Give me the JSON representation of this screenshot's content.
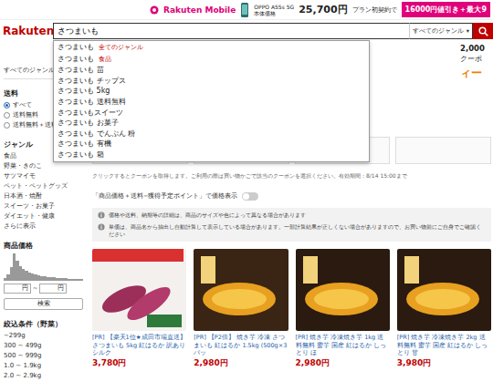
{
  "banner": {
    "brand": "Rakuten Mobile",
    "phone": "OPPO A55s 5G",
    "price_label": "本体価格",
    "price": "25,700円",
    "plan": "プラン初契約で",
    "offer": "16000円値引き＋最大9"
  },
  "header": {
    "logo": "Rakuten",
    "query": "さつまいも",
    "genre": "すべてのジャンル",
    "genre_arrow": "▾"
  },
  "suggestions": [
    {
      "text": "さつまいも",
      "tag": "全てのジャンル"
    },
    {
      "text": "さつまいも",
      "tag": "食品"
    },
    {
      "text": "さつまいも 苗",
      "tag": ""
    },
    {
      "text": "さつまいも チップス",
      "tag": ""
    },
    {
      "text": "さつまいも 5kg",
      "tag": ""
    },
    {
      "text": "さつまいも 送料無料",
      "tag": ""
    },
    {
      "text": "さつまいもスイーツ",
      "tag": ""
    },
    {
      "text": "さつまいも お菓子",
      "tag": ""
    },
    {
      "text": "さつまいも でんぷん 粉",
      "tag": ""
    },
    {
      "text": "さつまいも 有機",
      "tag": ""
    },
    {
      "text": "さつまいも 箱",
      "tag": ""
    }
  ],
  "promo": {
    "coupon_amount": "2,000",
    "coupon_label": "クーポ",
    "text": "ィー"
  },
  "sidebar": {
    "all_genres": "すべてのジャンル",
    "all_arrow": ">",
    "shipping": {
      "title": "送料",
      "options": [
        {
          "label": "すべて",
          "selected": true
        },
        {
          "label": "送料無料",
          "selected": false
        },
        {
          "label": "送料無料＋送料...",
          "selected": false
        }
      ]
    },
    "genre": {
      "title": "ジャンル",
      "items": [
        "食品",
        "野菜・きのこ",
        "サツマイモ",
        "ペット・ペットグッズ",
        "日本酒・焼酎",
        "スイーツ・お菓子",
        "ダイエット・健康"
      ],
      "more": "さらに表示"
    },
    "price": {
      "title": "商品価格",
      "histogram": [
        2,
        6,
        14,
        30,
        22,
        16,
        12,
        10,
        8,
        7,
        6,
        5,
        4,
        4,
        3,
        3,
        3,
        2,
        2,
        2,
        2,
        1,
        1,
        1,
        1,
        1
      ],
      "min_unit": "円",
      "separator": "~",
      "max_unit": "円",
      "button": "検索"
    },
    "weight": {
      "title": "絞込条件（野菜）",
      "items": [
        "~299g",
        "300 ~ 499g",
        "500 ~ 999g",
        "1.0 ~ 1.9kg",
        "2.0 ~ 2.9kg"
      ]
    }
  },
  "coupon_note": "クリックするとクーポンを取得します。ご利用の際は買い物かごで該当のクーポンを選択ください。有効期間：8/14 15:00まで",
  "toggle": {
    "label": "「商品価格＋送料−獲得予定ポイント」で価格表示",
    "on": false
  },
  "notices": [
    "価格や送料、納期等の詳細は、商品のサイズや色によって異なる場合があります",
    "単価は、商品名から抽出し自動計算して表示している場合があります。一部計算結果が正しくない場合がありますので、お買い物前にご自身でご確認ください"
  ],
  "products": [
    {
      "title": "[PR] 【楽天1位★成田市場直送】 さつまいも 5kg 紅はるか 訳ありシルク",
      "price": "3,780円",
      "color": "#f4f0ee"
    },
    {
      "title": "[PR] 【P2倍】 焼き芋 冷凍 さつまいも 紅はるか 1.5kg (500g×3パッ",
      "price": "2,980円",
      "color": "#3a2414"
    },
    {
      "title": "[PR] 焼き芋 冷凍焼き芋 1kg 送料無料 蜜芋 国産 紅はるか しっとり ほ",
      "price": "2,980円",
      "color": "#2a1a10"
    },
    {
      "title": "[PR] 焼き芋 冷凍焼き芋 2kg 送料無料 蜜芋 国産 紅はるか しっとり 甘",
      "price": "3,980円",
      "color": "#2a1a10"
    }
  ]
}
